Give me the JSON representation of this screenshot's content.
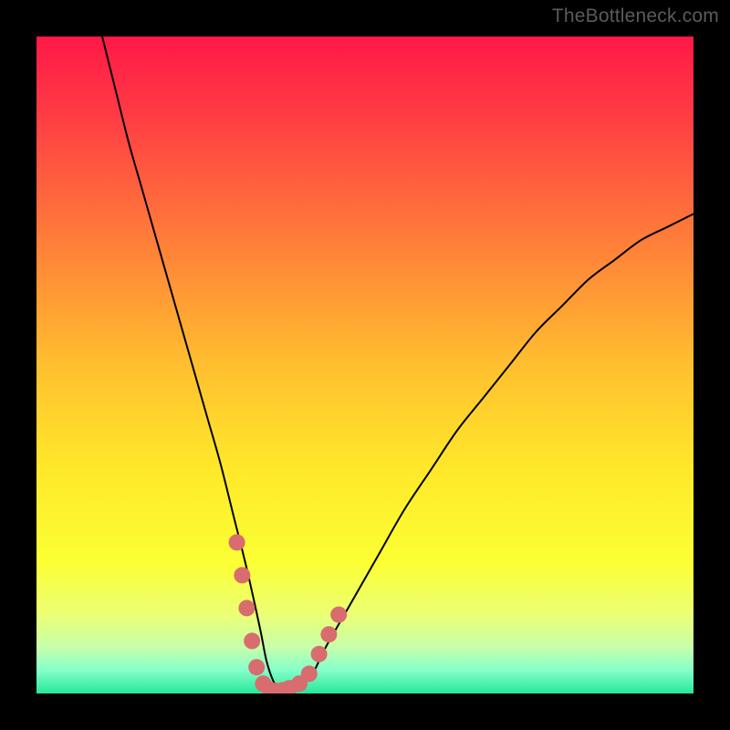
{
  "watermark": "TheBottleneck.com",
  "chart_data": {
    "type": "line",
    "title": "",
    "xlabel": "",
    "ylabel": "",
    "xlim": [
      0,
      100
    ],
    "ylim": [
      0,
      100
    ],
    "background": {
      "type": "vertical-gradient",
      "stops": [
        {
          "pos": 0.0,
          "color": "#ff1847"
        },
        {
          "pos": 0.12,
          "color": "#ff3c44"
        },
        {
          "pos": 0.3,
          "color": "#ff7a3a"
        },
        {
          "pos": 0.5,
          "color": "#ffbf2f"
        },
        {
          "pos": 0.66,
          "color": "#ffe92a"
        },
        {
          "pos": 0.8,
          "color": "#fbff33"
        },
        {
          "pos": 0.88,
          "color": "#ebff75"
        },
        {
          "pos": 0.93,
          "color": "#c6ffab"
        },
        {
          "pos": 0.965,
          "color": "#83ffca"
        },
        {
          "pos": 1.0,
          "color": "#25e799"
        }
      ]
    },
    "series": [
      {
        "name": "bottleneck-curve",
        "x": [
          10,
          12,
          14,
          16,
          18,
          20,
          22,
          24,
          26,
          28,
          30,
          32,
          34,
          35,
          36,
          37,
          38,
          40,
          42,
          44,
          48,
          52,
          56,
          60,
          64,
          68,
          72,
          76,
          80,
          84,
          88,
          92,
          96,
          100
        ],
        "y": [
          100,
          92,
          84,
          77,
          70,
          63,
          56,
          49,
          42,
          35,
          27,
          19,
          10,
          5,
          2,
          0.5,
          0.5,
          1,
          3,
          7,
          14,
          21,
          28,
          34,
          40,
          45,
          50,
          55,
          59,
          63,
          66,
          69,
          71,
          73
        ]
      }
    ],
    "markers": {
      "name": "highlight-points",
      "color": "#d86c6e",
      "points": [
        {
          "x": 30.5,
          "y": 23
        },
        {
          "x": 31.3,
          "y": 18
        },
        {
          "x": 32.0,
          "y": 13
        },
        {
          "x": 32.8,
          "y": 8
        },
        {
          "x": 33.5,
          "y": 4
        },
        {
          "x": 34.5,
          "y": 1.5
        },
        {
          "x": 35.5,
          "y": 0.6
        },
        {
          "x": 36.5,
          "y": 0.4
        },
        {
          "x": 37.5,
          "y": 0.5
        },
        {
          "x": 38.5,
          "y": 0.8
        },
        {
          "x": 40.0,
          "y": 1.5
        },
        {
          "x": 41.5,
          "y": 3
        },
        {
          "x": 43.0,
          "y": 6
        },
        {
          "x": 44.5,
          "y": 9
        },
        {
          "x": 46.0,
          "y": 12
        }
      ]
    }
  }
}
